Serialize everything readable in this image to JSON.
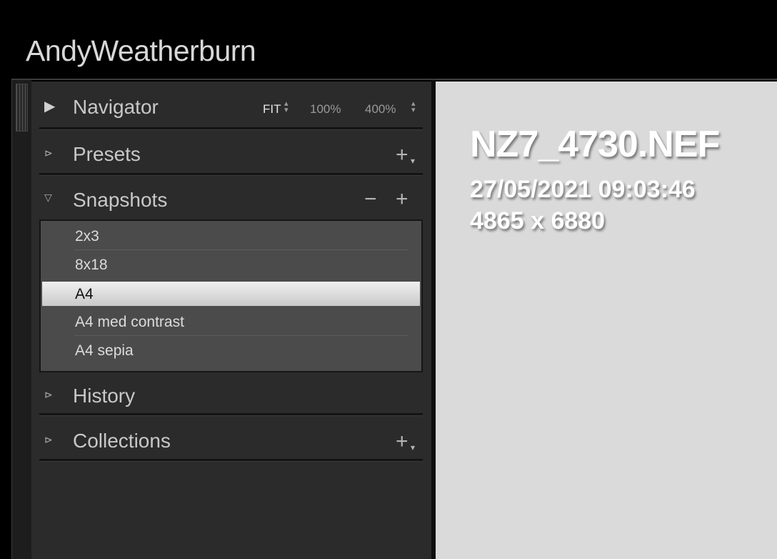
{
  "identity": {
    "plate_text": "AndyWeatherburn"
  },
  "panels": {
    "navigator": {
      "title": "Navigator",
      "expanded": true,
      "zoom_options": [
        "FIT",
        "100%",
        "400%"
      ],
      "selected_zoom": "FIT"
    },
    "presets": {
      "title": "Presets",
      "expanded": false,
      "add_label": "+"
    },
    "snapshots": {
      "title": "Snapshots",
      "expanded": true,
      "remove_label": "−",
      "add_label": "+",
      "items": [
        {
          "label": "2x3",
          "selected": false
        },
        {
          "label": "8x18",
          "selected": false
        },
        {
          "label": "A4",
          "selected": true
        },
        {
          "label": "A4 med contrast",
          "selected": false
        },
        {
          "label": "A4 sepia",
          "selected": false
        }
      ]
    },
    "history": {
      "title": "History",
      "expanded": false
    },
    "collections": {
      "title": "Collections",
      "expanded": false,
      "add_label": "+"
    }
  },
  "info_overlay": {
    "file_name": "NZ7_4730.NEF",
    "capture_datetime": "27/05/2021 09:03:46",
    "dimensions": "4865 x 6880"
  },
  "colors": {
    "panel_bg": "#2b2b2b",
    "main_bg": "#dadada",
    "selected_item_bg": "#e6e6e6"
  }
}
